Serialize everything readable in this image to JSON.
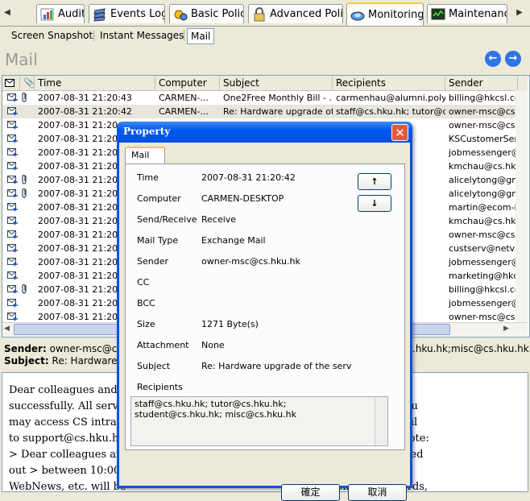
{
  "tabs": [
    {
      "label": "Audit"
    },
    {
      "label": "Events Log"
    },
    {
      "label": "Basic Policy"
    },
    {
      "label": "Advanced Policy"
    },
    {
      "label": "Monitoring"
    },
    {
      "label": "Maintenance"
    }
  ],
  "subtabs": [
    "Screen Snapshot",
    "Instant Messages",
    "Mail"
  ],
  "page_title": "Mail",
  "columns": [
    "Time",
    "Computer",
    "Subject",
    "Recipients",
    "Sender"
  ],
  "rows": [
    {
      "time": "2007-08-31 21:20:43",
      "computer": "CARMEN-...",
      "subject": "One2Free Monthly Bill - ...",
      "recipients": "carmenhau@alumni.poly...",
      "sender": "billing@hkcsl.com",
      "clip": true
    },
    {
      "time": "2007-08-31 21:20:42",
      "computer": "CARMEN-...",
      "subject": "Re: Hardware upgrade of...",
      "recipients": "staff@cs.hku.hk; tutor@c...",
      "sender": "owner-msc@cs.hku",
      "clip": false
    },
    {
      "time": "2007-08-31 21:20:41",
      "computer": "",
      "subject": "",
      "recipients": "",
      "sender": "owner-msc@cs.hku",
      "clip": false
    },
    {
      "time": "2007-08-31 21:20:40",
      "computer": "",
      "subject": "",
      "recipients": "",
      "sender": "KSCustomerServ",
      "clip": false
    },
    {
      "time": "2007-08-31 21:20:39",
      "computer": "",
      "subject": "",
      "recipients": "",
      "sender": "jobmessenger@...",
      "clip": false
    },
    {
      "time": "2007-08-31 21:20:38",
      "computer": "",
      "subject": "",
      "recipients": "",
      "sender": "kmchau@cs.hku.",
      "clip": false
    },
    {
      "time": "2007-08-31 21:20:37",
      "computer": "",
      "subject": "",
      "recipients": "oo.c...",
      "sender": "alicelytong@gm",
      "clip": true
    },
    {
      "time": "2007-08-31 21:20:25",
      "computer": "",
      "subject": "",
      "recipients": "oo.c...",
      "sender": "alicelytong@gm",
      "clip": true
    },
    {
      "time": "2007-08-31 21:20:14",
      "computer": "",
      "subject": "",
      "recipients": "",
      "sender": "martin@ecom-ic.",
      "clip": false
    },
    {
      "time": "2007-08-31 21:20:13",
      "computer": "",
      "subject": "",
      "recipients": "hku.hk",
      "sender": "kmchau@cs.hku.",
      "clip": false
    },
    {
      "time": "2007-08-31 21:20:12",
      "computer": "",
      "subject": "",
      "recipients": "tor@c...",
      "sender": "owner-msc@cs.hku",
      "clip": false
    },
    {
      "time": "2007-08-31 21:20:11",
      "computer": "",
      "subject": "",
      "recipients": "poly...",
      "sender": "custserv@netvig.",
      "clip": false
    },
    {
      "time": "2007-08-31 21:20:10",
      "computer": "",
      "subject": "",
      "recipients": "",
      "sender": "jobmessenger@...",
      "clip": false
    },
    {
      "time": "2007-08-31 21:20:09",
      "computer": "",
      "subject": "",
      "recipients": "poly...",
      "sender": "marketing@hkcs",
      "clip": false
    },
    {
      "time": "2007-08-31 21:20:08",
      "computer": "",
      "subject": "",
      "recipients": "poly...",
      "sender": "billing@hkcsl.co",
      "clip": true
    },
    {
      "time": "2007-08-31 21:20:07",
      "computer": "",
      "subject": "",
      "recipients": "",
      "sender": "jobmessenger@...",
      "clip": false
    },
    {
      "time": "2007-08-31 21:20:06",
      "computer": "",
      "subject": "",
      "recipients": "tor@c...",
      "sender": "owner-msc@cs.hku",
      "clip": false
    }
  ],
  "info": {
    "sender_label": "Sender:",
    "sender_value": "owner-msc@cs.hk",
    "sender_tail": ".hku.hk;misc@cs.hku.hk",
    "subject_label": "Subject:",
    "subject_value": "Re: Hardware u"
  },
  "body_lines": [
    "Dear colleagues and st                                                          een completed",
    "successfully. All servic                                                         p and running. You",
    "may access CS intrane                                                          e report by e-mail",
    "to support@cs.hku.hk                                                            Daniel Hung wrote:",
    "> Dear colleagues and                                                           net will be carried",
    "out > between 10:00 a                                                          n as WebMail,",
    "WebNews, etc. will be                                                           ation. > > Regards,"
  ],
  "dialog": {
    "title": "Property",
    "tab": "Mail",
    "fields": [
      {
        "label": "Time",
        "value": "2007-08-31 21:20:42"
      },
      {
        "label": "Computer",
        "value": "CARMEN-DESKTOP"
      },
      {
        "label": "Send/Receive",
        "value": "Receive"
      },
      {
        "label": "Mail Type",
        "value": "Exchange Mail"
      },
      {
        "label": "Sender",
        "value": "owner-msc@cs.hku.hk"
      },
      {
        "label": "CC",
        "value": ""
      },
      {
        "label": "BCC",
        "value": ""
      },
      {
        "label": "Size",
        "value": "1271 Byte(s)"
      },
      {
        "label": "Attachment",
        "value": "None"
      },
      {
        "label": "Subject",
        "value": "Re: Hardware upgrade of the server for"
      }
    ],
    "recipients_label": "Recipients",
    "recipients_value": "staff@cs.hku.hk; tutor@cs.hku.hk; student@cs.hku.hk; misc@cs.hku.hk",
    "up_icon": "↑",
    "down_icon": "↓",
    "ok_label": "確定",
    "cancel_label": "取消"
  },
  "colors": {
    "accent": "#0054e3",
    "tab_highlight": "#ffc83c",
    "nav_blue": "#2d74e6"
  }
}
